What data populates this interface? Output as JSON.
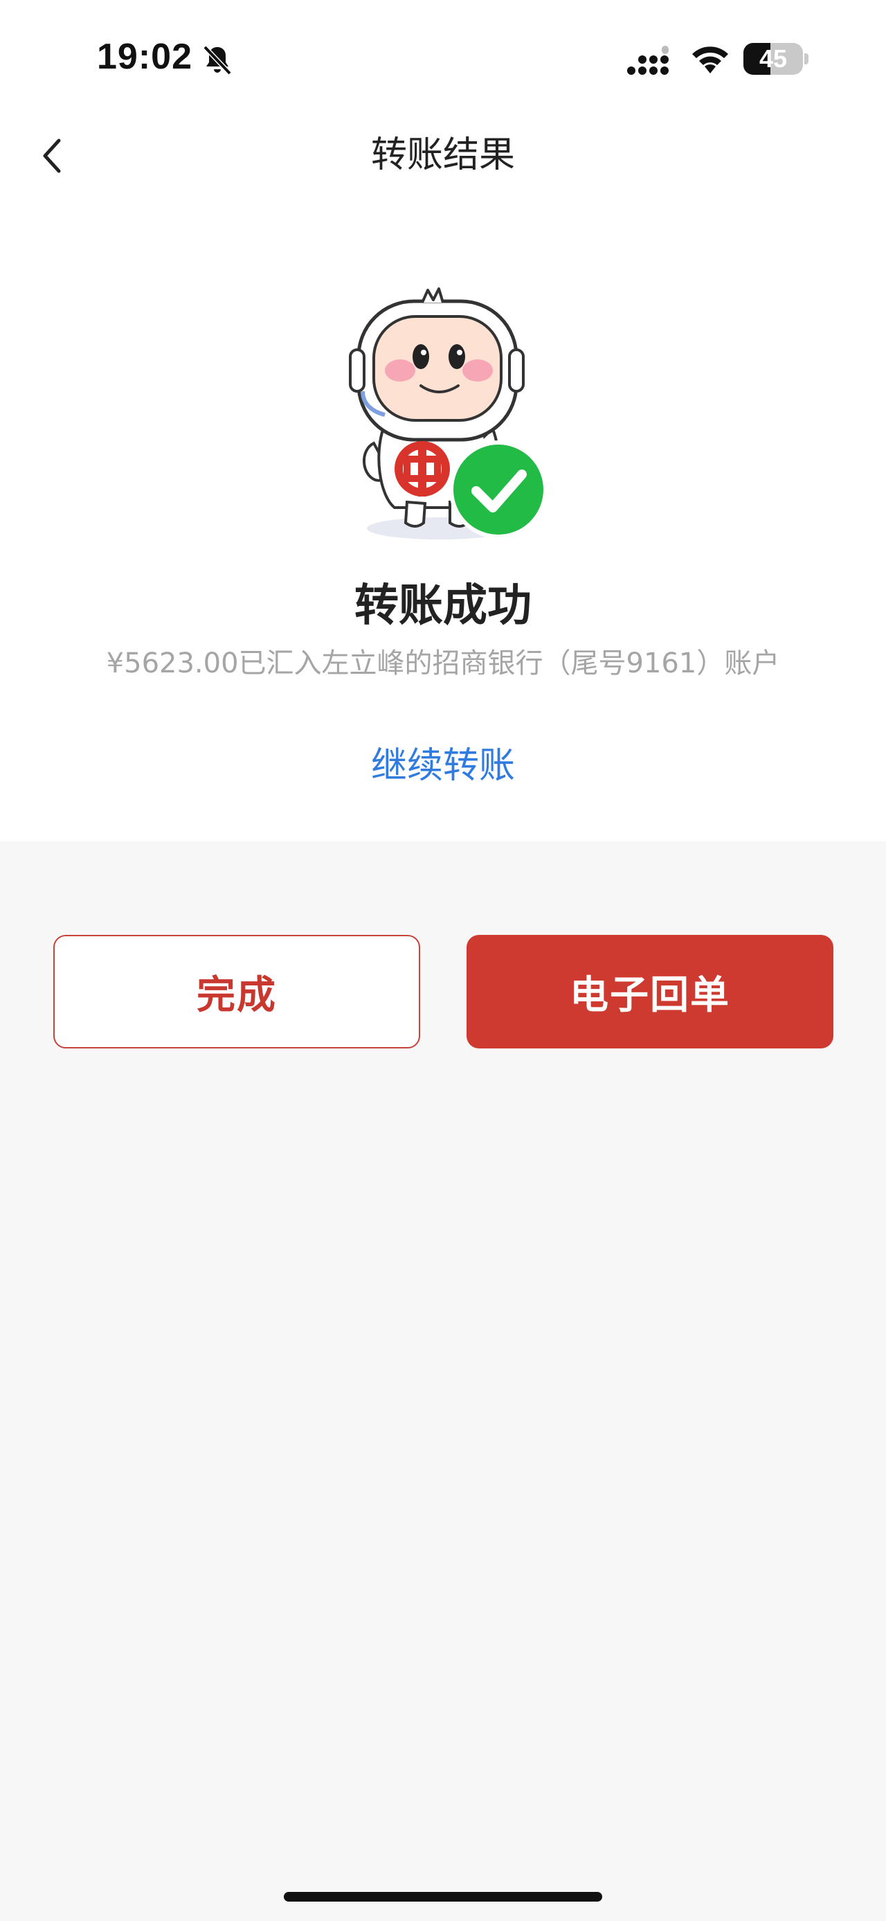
{
  "status_bar": {
    "time": "19:02",
    "battery_level": "45",
    "battery_fraction": 0.45,
    "icons": [
      "bell-muted-icon",
      "cellular-signal-icon",
      "wifi-icon",
      "battery-icon"
    ]
  },
  "nav": {
    "back_icon": "chevron-left-icon",
    "title": "转账结果"
  },
  "result": {
    "mascot_icon": "bank-mascot-success-illustration",
    "title": "转账成功",
    "description": "¥5623.00已汇入左立峰的招商银行（尾号9161）账户",
    "continue_label": "继续转账"
  },
  "actions": {
    "done_label": "完成",
    "receipt_label": "电子回单"
  },
  "colors": {
    "accent_red": "#cf3a30",
    "link_blue": "#2f7be0",
    "success_green": "#22bb45",
    "muted_text": "#a5a5a5",
    "page_bg": "#f7f7f7"
  }
}
